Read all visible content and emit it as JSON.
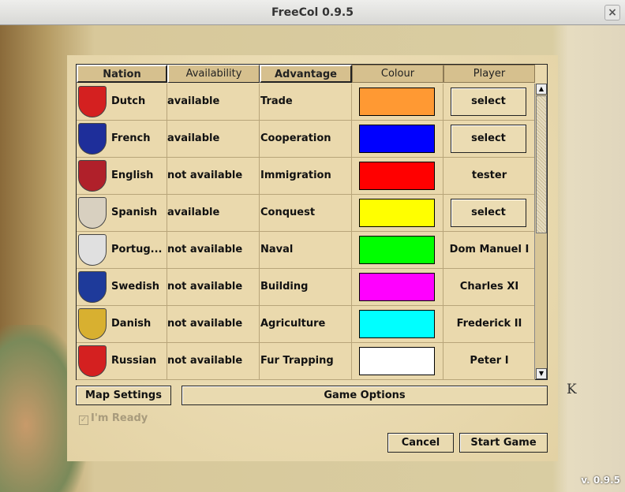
{
  "window": {
    "title": "FreeCol 0.9.5",
    "close": "×"
  },
  "background": {
    "map_letter": "K",
    "version": "v. 0.9.5"
  },
  "table": {
    "headers": [
      "Nation",
      "Availability",
      "Advantage",
      "Colour",
      "Player"
    ],
    "rows": [
      {
        "nation": "Dutch",
        "availability": "available",
        "advantage": "Trade",
        "colour": "#ff9933",
        "player": "select",
        "player_is_button": true,
        "shield": "#d42020"
      },
      {
        "nation": "French",
        "availability": "available",
        "advantage": "Cooperation",
        "colour": "#0000ff",
        "player": "select",
        "player_is_button": true,
        "shield": "#1e2e9a"
      },
      {
        "nation": "English",
        "availability": "not available",
        "advantage": "Immigration",
        "colour": "#ff0000",
        "player": "tester",
        "player_is_button": false,
        "shield": "#b0202a"
      },
      {
        "nation": "Spanish",
        "availability": "available",
        "advantage": "Conquest",
        "colour": "#ffff00",
        "player": "select",
        "player_is_button": true,
        "shield": "#d8d0c0"
      },
      {
        "nation": "Portug...",
        "availability": "not available",
        "advantage": "Naval",
        "colour": "#00ff00",
        "player": "Dom Manuel I",
        "player_is_button": false,
        "shield": "#e0e0e0"
      },
      {
        "nation": "Swedish",
        "availability": "not available",
        "advantage": "Building",
        "colour": "#ff00ff",
        "player": "Charles XI",
        "player_is_button": false,
        "shield": "#1e3a9a"
      },
      {
        "nation": "Danish",
        "availability": "not available",
        "advantage": "Agriculture",
        "colour": "#00ffff",
        "player": "Frederick II",
        "player_is_button": false,
        "shield": "#d8b030"
      },
      {
        "nation": "Russian",
        "availability": "not available",
        "advantage": "Fur Trapping",
        "colour": "#ffffff",
        "player": "Peter I",
        "player_is_button": false,
        "shield": "#d42020"
      }
    ]
  },
  "buttons": {
    "map_settings": "Map Settings",
    "game_options": "Game Options",
    "cancel": "Cancel",
    "start_game": "Start Game"
  },
  "ready": {
    "label": "I'm Ready",
    "checked": true,
    "check": "✓"
  }
}
